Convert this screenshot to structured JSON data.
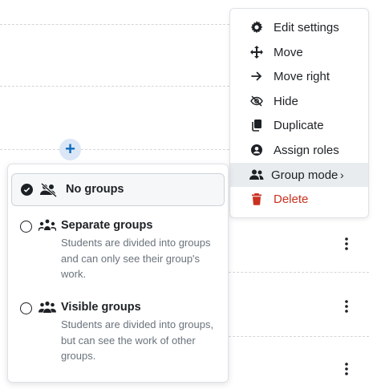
{
  "action_menu": {
    "items": [
      {
        "label": "Edit settings",
        "icon": "gear-icon"
      },
      {
        "label": "Move",
        "icon": "move-icon"
      },
      {
        "label": "Move right",
        "icon": "arrow-right-icon"
      },
      {
        "label": "Hide",
        "icon": "eye-slash-icon"
      },
      {
        "label": "Duplicate",
        "icon": "copy-icon"
      },
      {
        "label": "Assign roles",
        "icon": "user-circle-icon"
      },
      {
        "label": "Group mode",
        "icon": "users-icon",
        "active": true,
        "chevron": "›"
      },
      {
        "label": "Delete",
        "icon": "trash-icon",
        "color": "#ca3120"
      }
    ]
  },
  "add_button": {
    "symbol": "+"
  },
  "group_mode_menu": {
    "options": [
      {
        "title": "No groups",
        "description": "",
        "selected": true
      },
      {
        "title": "Separate groups",
        "description": "Students are divided into groups and can only see their group's work.",
        "selected": false
      },
      {
        "title": "Visible groups",
        "description": "Students are divided into groups, but can see the work of other groups.",
        "selected": false
      }
    ]
  },
  "colors": {
    "accent": "#0f6cbf",
    "danger": "#ca3120",
    "text": "#1d2125",
    "muted": "#6a737b"
  }
}
